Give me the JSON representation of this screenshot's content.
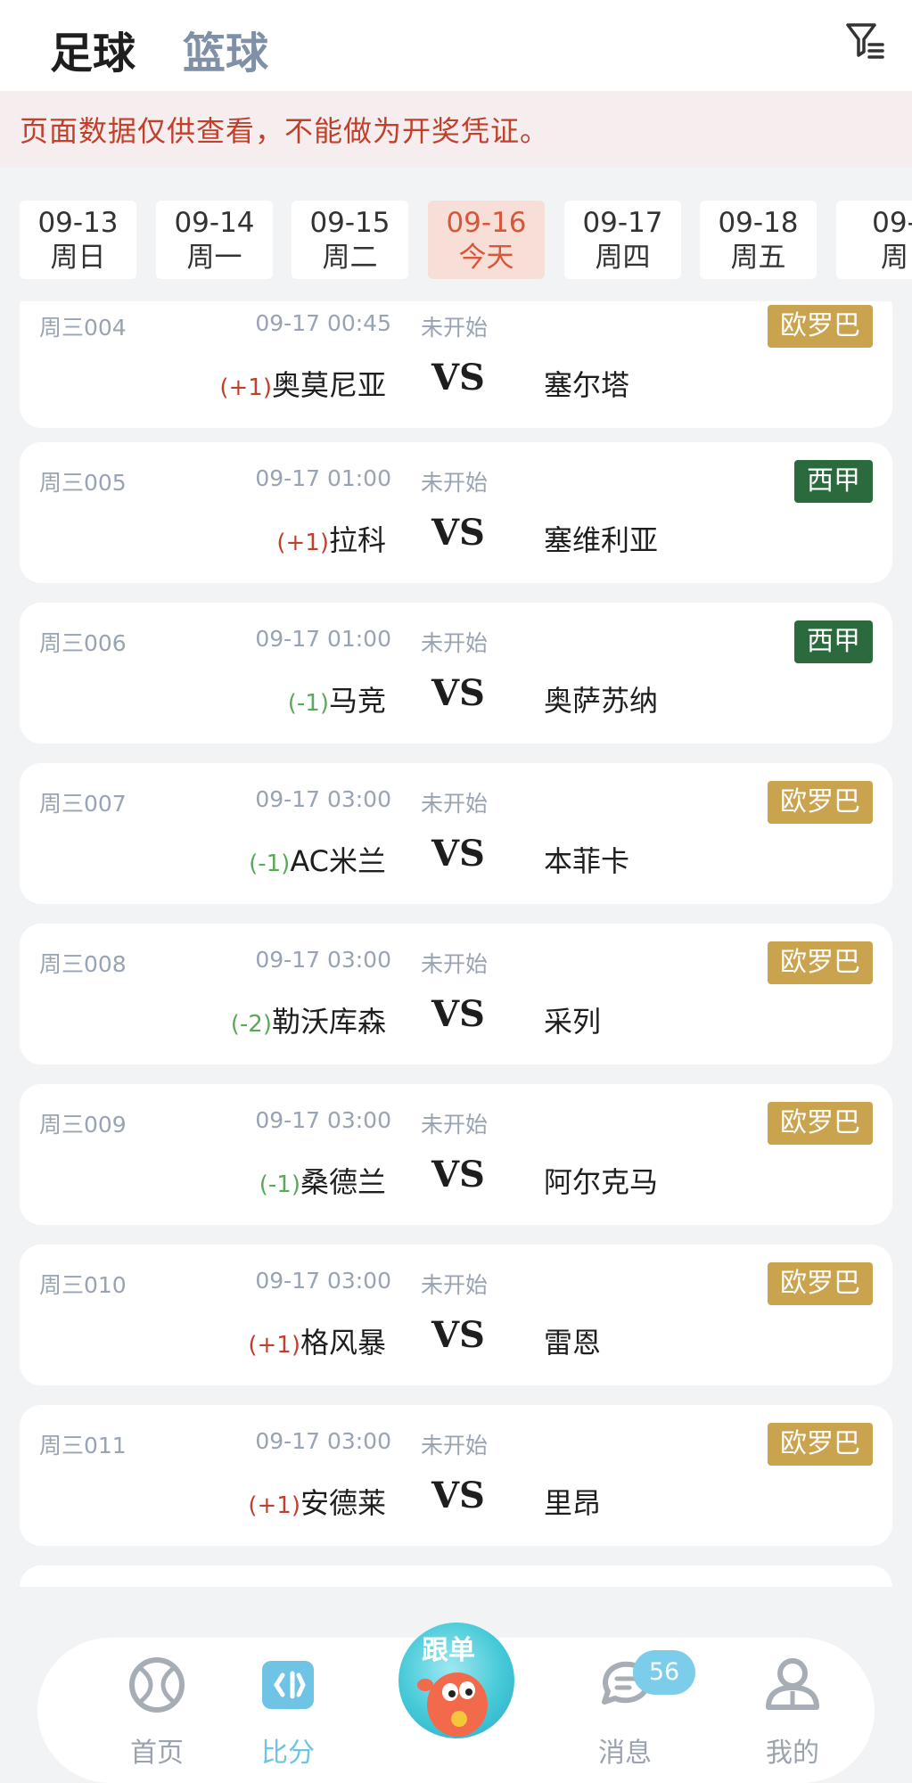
{
  "header": {
    "tabs": [
      {
        "label": "足球",
        "active": true
      },
      {
        "label": "篮球",
        "active": false
      }
    ],
    "filter_icon": "filter-icon"
  },
  "notice": "页面数据仅供查看，不能做为开奖凭证。",
  "dates": [
    {
      "date": "09-13",
      "day": "周日"
    },
    {
      "date": "09-14",
      "day": "周一"
    },
    {
      "date": "09-15",
      "day": "周二"
    },
    {
      "date": "09-16",
      "day": "今天",
      "active": true
    },
    {
      "date": "09-17",
      "day": "周四"
    },
    {
      "date": "09-18",
      "day": "周五"
    },
    {
      "date": "09-",
      "day": "周"
    }
  ],
  "colors": {
    "league_europa": "#c9a34d",
    "league_laliga": "#2b6a3c",
    "handicap_plus": "#c0402c",
    "handicap_minus": "#5aa95a",
    "active_date": "#d8563a",
    "active_tab": "#6fc4e6"
  },
  "matches": [
    {
      "code": "周三004",
      "time": "09-17 00:45",
      "status": "未开始",
      "league": "欧罗巴",
      "league_color": "#c9a34d",
      "handicap": "(+1)",
      "handicap_color": "#c0402c",
      "home": "奥莫尼亚",
      "vs": "VS",
      "away": "塞尔塔"
    },
    {
      "code": "周三005",
      "time": "09-17 01:00",
      "status": "未开始",
      "league": "西甲",
      "league_color": "#2b6a3c",
      "handicap": "(+1)",
      "handicap_color": "#c0402c",
      "home": "拉科",
      "vs": "VS",
      "away": "塞维利亚"
    },
    {
      "code": "周三006",
      "time": "09-17 01:00",
      "status": "未开始",
      "league": "西甲",
      "league_color": "#2b6a3c",
      "handicap": "(-1)",
      "handicap_color": "#5aa95a",
      "home": "马竞",
      "vs": "VS",
      "away": "奥萨苏纳"
    },
    {
      "code": "周三007",
      "time": "09-17 03:00",
      "status": "未开始",
      "league": "欧罗巴",
      "league_color": "#c9a34d",
      "handicap": "(-1)",
      "handicap_color": "#5aa95a",
      "home": "AC米兰",
      "vs": "VS",
      "away": "本菲卡"
    },
    {
      "code": "周三008",
      "time": "09-17 03:00",
      "status": "未开始",
      "league": "欧罗巴",
      "league_color": "#c9a34d",
      "handicap": "(-2)",
      "handicap_color": "#5aa95a",
      "home": "勒沃库森",
      "vs": "VS",
      "away": "采列"
    },
    {
      "code": "周三009",
      "time": "09-17 03:00",
      "status": "未开始",
      "league": "欧罗巴",
      "league_color": "#c9a34d",
      "handicap": "(-1)",
      "handicap_color": "#5aa95a",
      "home": "桑德兰",
      "vs": "VS",
      "away": "阿尔克马"
    },
    {
      "code": "周三010",
      "time": "09-17 03:00",
      "status": "未开始",
      "league": "欧罗巴",
      "league_color": "#c9a34d",
      "handicap": "(+1)",
      "handicap_color": "#c0402c",
      "home": "格风暴",
      "vs": "VS",
      "away": "雷恩"
    },
    {
      "code": "周三011",
      "time": "09-17 03:00",
      "status": "未开始",
      "league": "欧罗巴",
      "league_color": "#c9a34d",
      "handicap": "(+1)",
      "handicap_color": "#c0402c",
      "home": "安德莱",
      "vs": "VS",
      "away": "里昂"
    }
  ],
  "bottom_nav": [
    {
      "label": "首页",
      "icon": "ball-icon"
    },
    {
      "label": "比分",
      "icon": "score-icon",
      "active": true
    },
    {
      "label": "跟单",
      "icon": "follow-mascot-icon"
    },
    {
      "label": "消息",
      "icon": "message-icon",
      "badge": "56"
    },
    {
      "label": "我的",
      "icon": "user-icon"
    }
  ]
}
